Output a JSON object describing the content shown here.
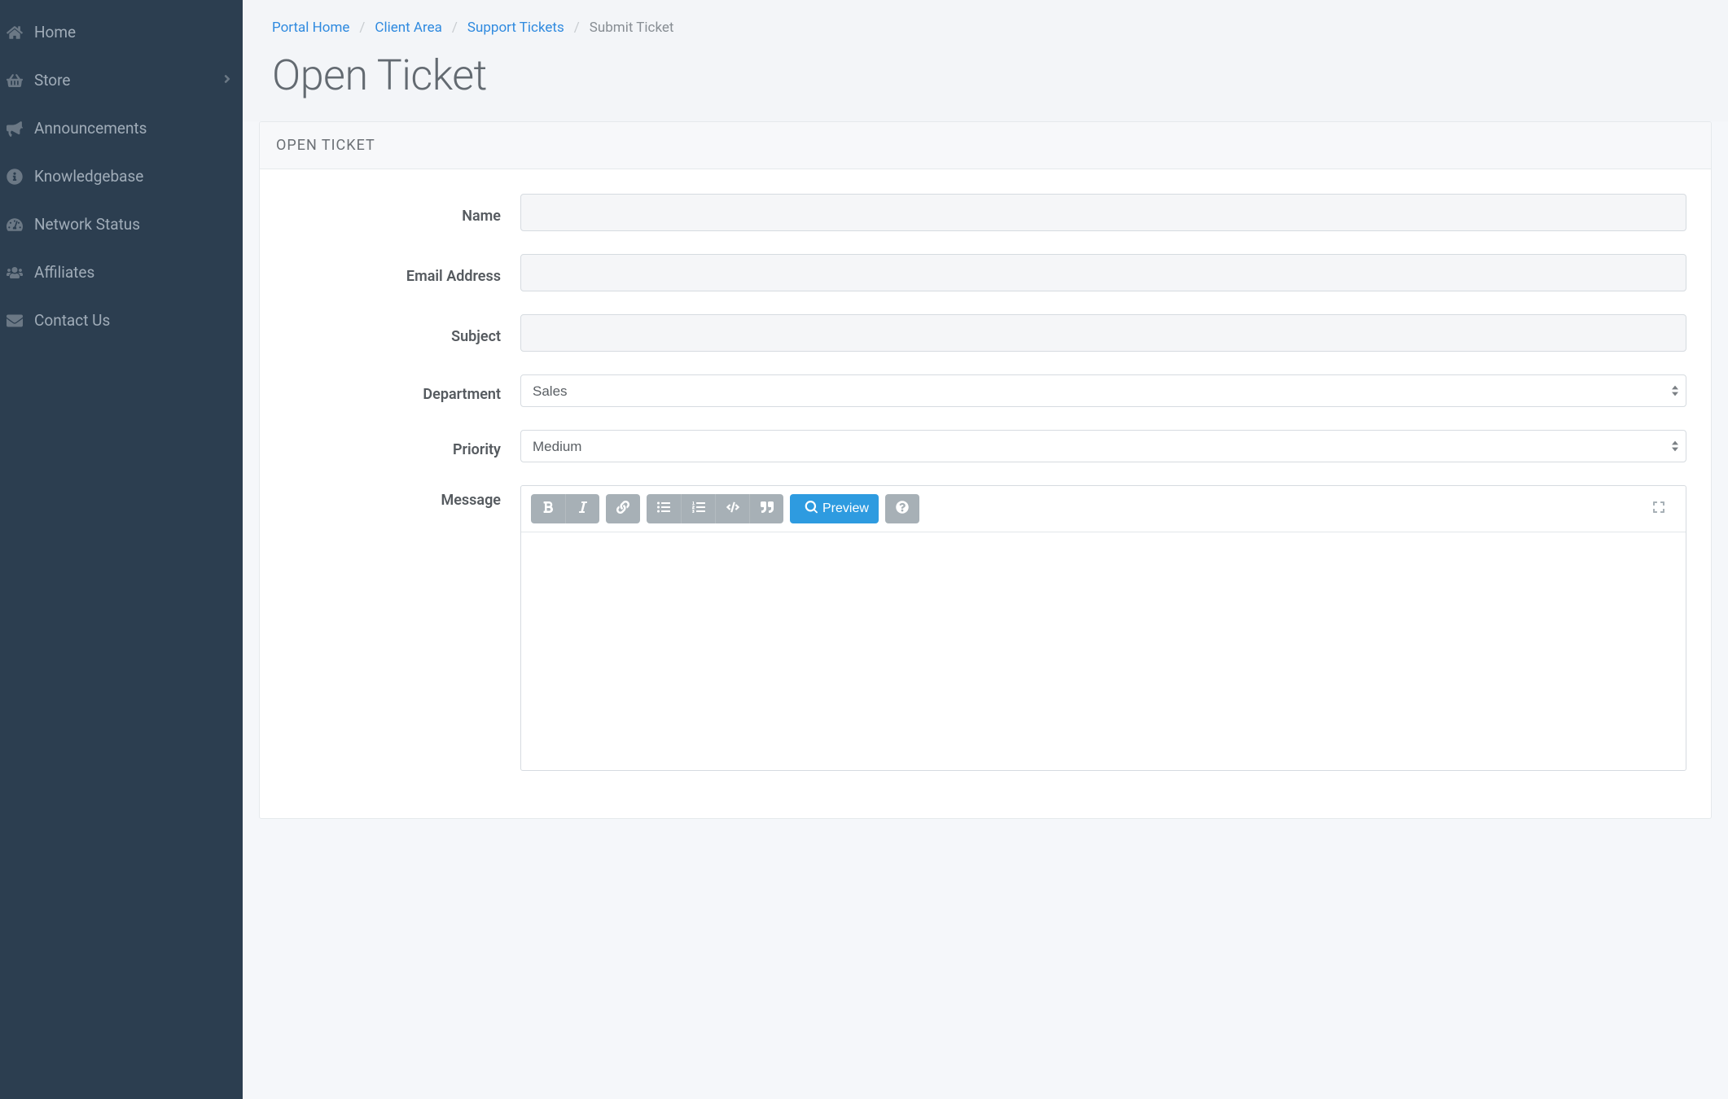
{
  "sidebar": {
    "items": [
      {
        "label": "Home",
        "icon": "home-icon",
        "has_children": false
      },
      {
        "label": "Store",
        "icon": "basket-icon",
        "has_children": true
      },
      {
        "label": "Announcements",
        "icon": "bullhorn-icon",
        "has_children": false
      },
      {
        "label": "Knowledgebase",
        "icon": "info-circle-icon",
        "has_children": false
      },
      {
        "label": "Network Status",
        "icon": "dashboard-icon",
        "has_children": false
      },
      {
        "label": "Affiliates",
        "icon": "users-icon",
        "has_children": false
      },
      {
        "label": "Contact Us",
        "icon": "envelope-icon",
        "has_children": false
      }
    ]
  },
  "breadcrumb": {
    "items": [
      {
        "label": "Portal Home",
        "link": true
      },
      {
        "label": "Client Area",
        "link": true
      },
      {
        "label": "Support Tickets",
        "link": true
      },
      {
        "label": "Submit Ticket",
        "link": false
      }
    ]
  },
  "page": {
    "title": "Open Ticket"
  },
  "panel": {
    "title": "OPEN TICKET"
  },
  "form": {
    "name": {
      "label": "Name",
      "value": ""
    },
    "email": {
      "label": "Email Address",
      "value": ""
    },
    "subject": {
      "label": "Subject",
      "value": ""
    },
    "department": {
      "label": "Department",
      "value": "Sales"
    },
    "priority": {
      "label": "Priority",
      "value": "Medium"
    },
    "message": {
      "label": "Message",
      "value": ""
    }
  },
  "editor": {
    "preview_label": "Preview"
  }
}
